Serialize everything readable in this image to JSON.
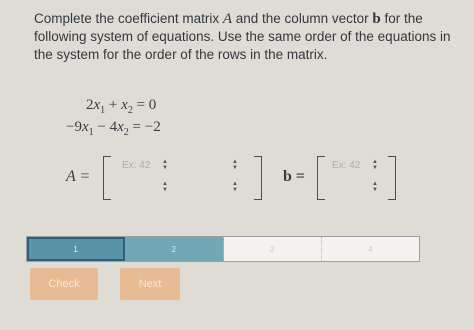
{
  "prompt": {
    "part1": "Complete the coefficient matrix ",
    "matrix_symbol": "A",
    "part2": " and the column vector ",
    "vector_symbol": "b",
    "part3": " for the following system of equations. Use the same order of the equations in the system for the order of the rows in the matrix."
  },
  "system": {
    "eq1": {
      "c1": "2",
      "v1": "x",
      "s1": "1",
      "op": " + ",
      "v2": "x",
      "s2": "2",
      "rhs": " = 0"
    },
    "eq2": {
      "c1": "−9",
      "v1": "x",
      "s1": "1",
      "op": " − 4",
      "v2": "x",
      "s2": "2",
      "rhs": " = −2"
    }
  },
  "matrix": {
    "label": "A =",
    "cells": [
      {
        "placeholder": "Ex: 42"
      },
      {
        "placeholder": ""
      },
      {
        "placeholder": ""
      },
      {
        "placeholder": ""
      }
    ]
  },
  "vector": {
    "label": "b =",
    "cells": [
      {
        "placeholder": "Ex: 42"
      },
      {
        "placeholder": ""
      }
    ]
  },
  "spinner": {
    "up": "▲",
    "down": "▼"
  },
  "progress": {
    "segments": [
      {
        "label": "1",
        "state": "current"
      },
      {
        "label": "2",
        "state": "done"
      },
      {
        "label": "3",
        "state": "todo"
      },
      {
        "label": "4",
        "state": "todo"
      }
    ]
  },
  "buttons": {
    "check": "Check",
    "next": "Next"
  },
  "colors": {
    "progress_active": "#5a93a8",
    "button": "#e8bb94",
    "background": "#dfdcd6"
  }
}
